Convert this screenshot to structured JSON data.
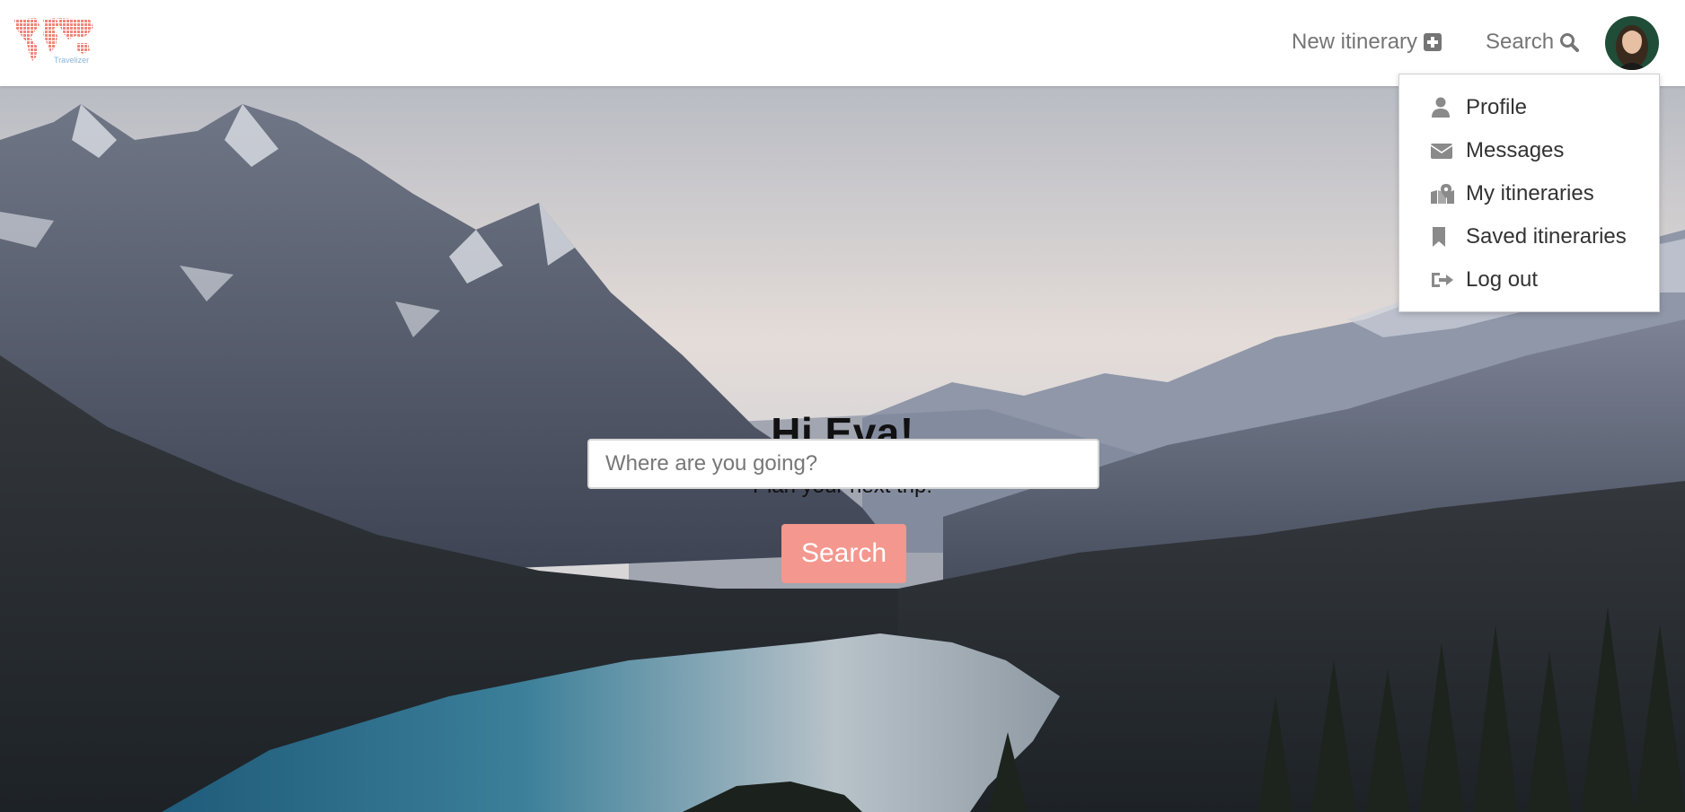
{
  "brand": {
    "name": "Travelizer",
    "logo_icon": "world-map-dots-icon",
    "logo_color": "#f2867a"
  },
  "nav": {
    "new_itinerary_label": "New itinerary",
    "new_itinerary_icon": "plus-square-icon",
    "search_label": "Search",
    "search_icon": "search-icon",
    "avatar_icon": "user-avatar"
  },
  "dropdown": {
    "items": [
      {
        "label": "Profile",
        "icon": "user-icon"
      },
      {
        "label": "Messages",
        "icon": "envelope-icon"
      },
      {
        "label": "My itineraries",
        "icon": "map-marker-icon"
      },
      {
        "label": "Saved itineraries",
        "icon": "bookmark-icon"
      },
      {
        "label": "Log out",
        "icon": "sign-out-icon"
      }
    ]
  },
  "hero": {
    "greeting": "Hi Eva!",
    "subtitle": "Plan your next trip!",
    "input_placeholder": "Where are you going?",
    "search_button": "Search",
    "accent_color": "#f4978e"
  }
}
